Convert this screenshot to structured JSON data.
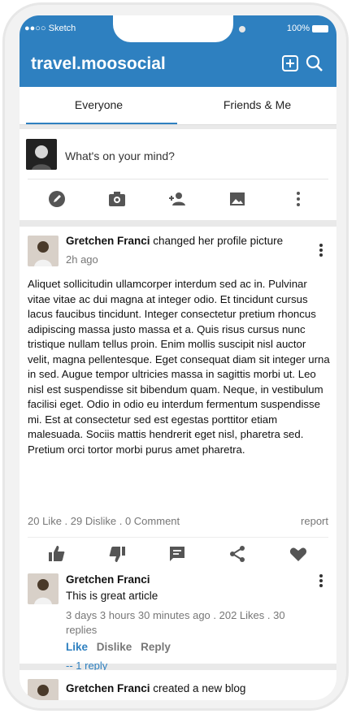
{
  "status_bar": {
    "left": "●●○○ Sketch",
    "right": "100%"
  },
  "header": {
    "brand": "travel.moosocial"
  },
  "tabs": [
    {
      "label": "Everyone"
    },
    {
      "label": "Friends & Me"
    }
  ],
  "composer": {
    "placeholder": "What's on your mind?"
  },
  "post": {
    "author": "Gretchen Franci",
    "action": " changed her profile picture",
    "time": "2h ago",
    "body": "Aliquet sollicitudin ullamcorper interdum sed ac in. Pulvinar vitae vitae ac dui magna at integer odio. Et tincidunt cursus lacus faucibus tincidunt. Integer consectetur pretium rhoncus adipiscing massa justo massa et a. Quis risus cursus nunc tristique nullam tellus proin. Enim mollis suscipit nisl auctor velit, magna pellentesque. Eget consequat diam sit integer urna in sed. Augue tempor ultricies massa in sagittis morbi ut. Leo nisl est suspendisse sit bibendum quam. Neque, in vestibulum facilisi eget. Odio in odio eu interdum fermentum suspendisse mi. Est at consectetur sed est egestas porttitor etiam malesuada. Sociis mattis hendrerit eget nisl, pharetra sed. Pretium orci tortor morbi purus amet pharetra.",
    "stats": "20 Like  .  29 Dislike  .  0 Comment",
    "report": "report"
  },
  "comment": {
    "author": "Gretchen Franci",
    "text": "This is great article",
    "meta": "3 days 3 hours 30 minutes ago . 202 Likes . 30 replies",
    "like": "Like",
    "dislike": "Dislike",
    "reply": "Reply",
    "replies": "-- 1 reply"
  },
  "post2": {
    "author": "Gretchen Franci",
    "action": " created a new blog"
  },
  "colors": {
    "primary": "#2e80c0",
    "text": "#111111",
    "muted": "#777777",
    "icon": "#555555"
  }
}
